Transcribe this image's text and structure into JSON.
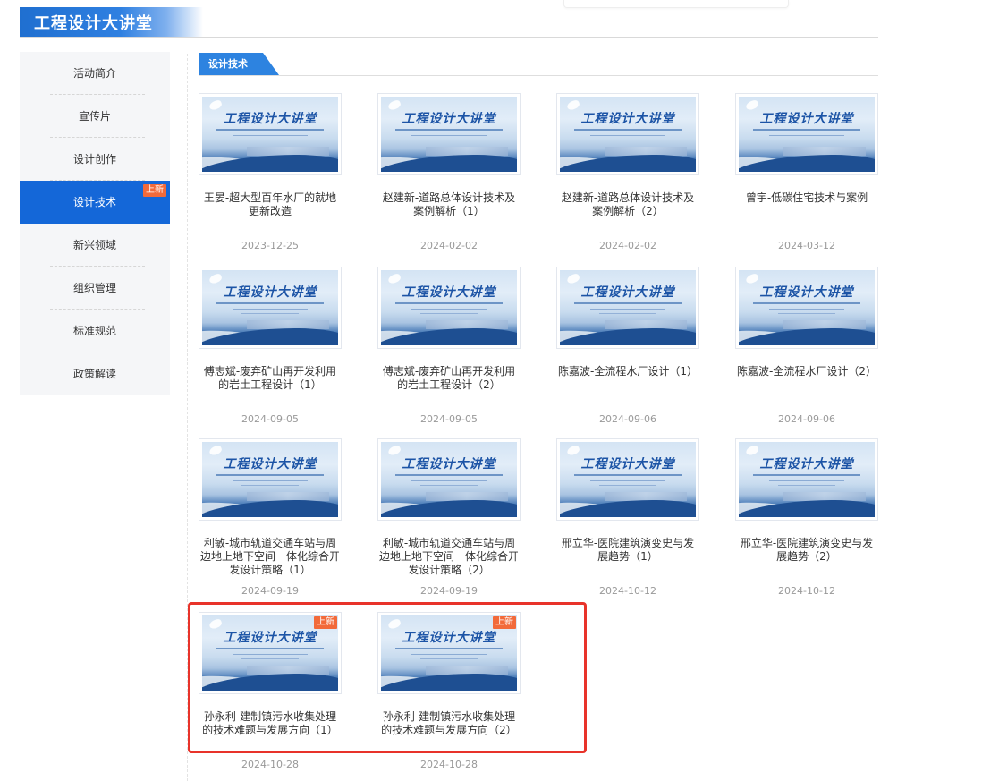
{
  "header": {
    "title": "工程设计大讲堂"
  },
  "sidebar": {
    "items": [
      {
        "label": "活动简介",
        "active": false,
        "badge": ""
      },
      {
        "label": "宣传片",
        "active": false,
        "badge": ""
      },
      {
        "label": "设计创作",
        "active": false,
        "badge": ""
      },
      {
        "label": "设计技术",
        "active": true,
        "badge": "上新"
      },
      {
        "label": "新兴领域",
        "active": false,
        "badge": ""
      },
      {
        "label": "组织管理",
        "active": false,
        "badge": ""
      },
      {
        "label": "标准规范",
        "active": false,
        "badge": ""
      },
      {
        "label": "政策解读",
        "active": false,
        "badge": ""
      }
    ]
  },
  "section": {
    "title": "设计技术"
  },
  "thumbnail": {
    "title": "工程设计大讲堂"
  },
  "cards": [
    {
      "title": "王晏-超大型百年水厂的就地更新改造",
      "date": "2023-12-25",
      "badge": ""
    },
    {
      "title": "赵建新-道路总体设计技术及案例解析（1）",
      "date": "2024-02-02",
      "badge": ""
    },
    {
      "title": "赵建新-道路总体设计技术及案例解析（2）",
      "date": "2024-02-02",
      "badge": ""
    },
    {
      "title": "曾宇-低碳住宅技术与案例",
      "date": "2024-03-12",
      "badge": ""
    },
    {
      "title": "傅志斌-废弃矿山再开发利用的岩土工程设计（1）",
      "date": "2024-09-05",
      "badge": ""
    },
    {
      "title": "傅志斌-废弃矿山再开发利用的岩土工程设计（2）",
      "date": "2024-09-05",
      "badge": ""
    },
    {
      "title": "陈嘉波-全流程水厂设计（1）",
      "date": "2024-09-06",
      "badge": ""
    },
    {
      "title": "陈嘉波-全流程水厂设计（2）",
      "date": "2024-09-06",
      "badge": ""
    },
    {
      "title": "利敏-城市轨道交通车站与周边地上地下空间一体化综合开发设计策略（1）",
      "date": "2024-09-19",
      "badge": ""
    },
    {
      "title": "利敏-城市轨道交通车站与周边地上地下空间一体化综合开发设计策略（2）",
      "date": "2024-09-19",
      "badge": ""
    },
    {
      "title": "邢立华-医院建筑演变史与发展趋势（1）",
      "date": "2024-10-12",
      "badge": ""
    },
    {
      "title": "邢立华-医院建筑演变史与发展趋势（2）",
      "date": "2024-10-12",
      "badge": ""
    },
    {
      "title": "孙永利-建制镇污水收集处理的技术难题与发展方向（1）",
      "date": "2024-10-28",
      "badge": "上新"
    },
    {
      "title": "孙永利-建制镇污水收集处理的技术难题与发展方向（2）",
      "date": "2024-10-28",
      "badge": "上新"
    }
  ],
  "colors": {
    "accent": "#1467d8",
    "tab": "#2d83e0",
    "badge": "#f26a3a",
    "highlight": "#e8332a"
  }
}
